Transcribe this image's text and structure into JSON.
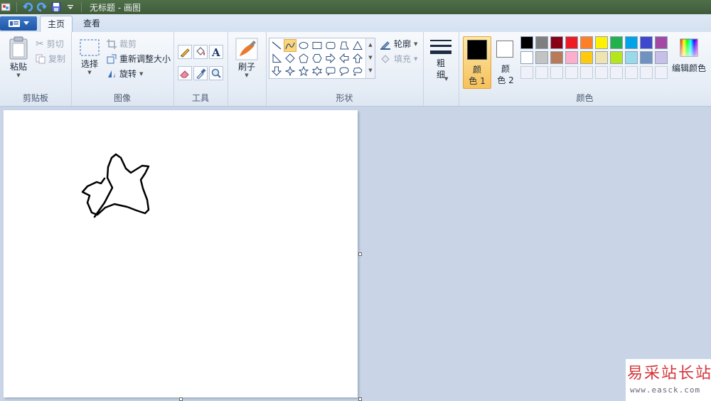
{
  "window": {
    "title": "无标题 - 画图"
  },
  "tabs": [
    {
      "label": "主页",
      "active": true
    },
    {
      "label": "查看",
      "active": false
    }
  ],
  "clipboard": {
    "group": "剪贴板",
    "paste": "粘贴",
    "cut": "剪切",
    "copy": "复制"
  },
  "image": {
    "group": "图像",
    "select": "选择",
    "crop": "裁剪",
    "resize": "重新调整大小",
    "rotate": "旋转"
  },
  "tools": {
    "group": "工具"
  },
  "brush": {
    "label": "刷子"
  },
  "shapes": {
    "group": "形状",
    "outline": "轮廓",
    "fill": "填充"
  },
  "size": {
    "label_line1": "粗",
    "label_line2": "细"
  },
  "colors": {
    "group": "颜色",
    "color1_line1": "颜",
    "color1_line2": "色 1",
    "color2_line1": "颜",
    "color2_line2": "色 2",
    "edit": "编辑颜色",
    "color1": "#000000",
    "color2": "#ffffff",
    "row1": [
      "#000000",
      "#7f7f7f",
      "#880015",
      "#ed1c24",
      "#ff7f27",
      "#fff200",
      "#22b14c",
      "#00a2e8",
      "#3f48cc",
      "#a349a4"
    ],
    "row2": [
      "#ffffff",
      "#c3c3c3",
      "#b97a57",
      "#ffaec9",
      "#ffc90e",
      "#efe4b0",
      "#b5e61d",
      "#99d9ea",
      "#7092be",
      "#c8bfe7"
    ]
  },
  "watermark": {
    "title": "易采站长站",
    "url": "www.easck.com"
  }
}
